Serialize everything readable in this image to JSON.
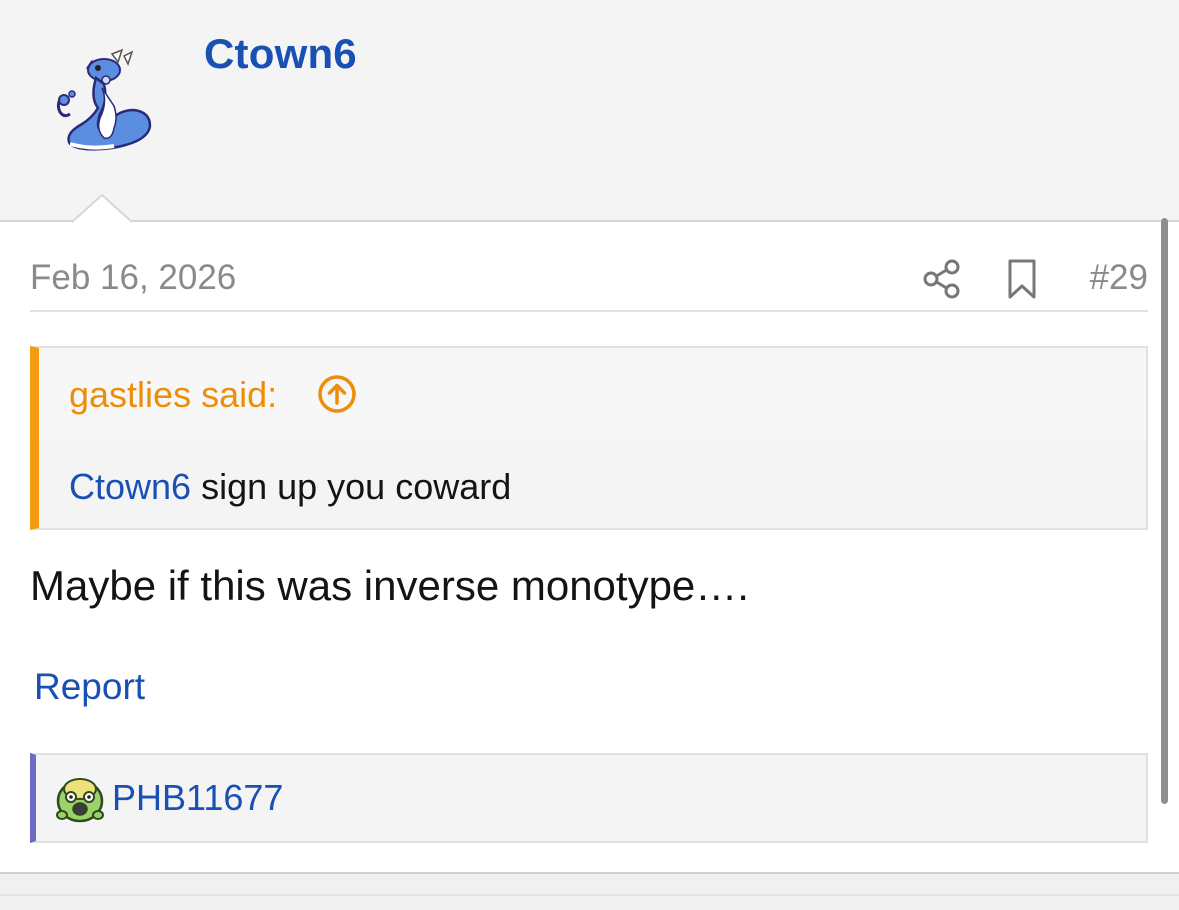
{
  "post": {
    "author": {
      "username": "Ctown6",
      "avatar_icon": "dragonair-sprite"
    },
    "date": "Feb 16, 2026",
    "post_number": "#29",
    "actions": {
      "share_icon": "share-icon",
      "bookmark_icon": "bookmark-icon"
    },
    "quote": {
      "author_label": "gastlies said:",
      "jump_icon": "arrow-up-circle-icon",
      "mention": "Ctown6",
      "text": " sign up you coward",
      "accent_color": "#f39c12"
    },
    "message": "Maybe if this was inverse monotype….",
    "report_label": "Report",
    "reactions": {
      "users": [
        {
          "name": "PHB11677",
          "avatar_icon": "shellos-sprite"
        }
      ],
      "accent_color": "#6c6cc4"
    }
  },
  "colors": {
    "link": "#1950b4",
    "background": "#f4f4f4",
    "card": "#ffffff",
    "muted_text": "#8a8a8a"
  }
}
